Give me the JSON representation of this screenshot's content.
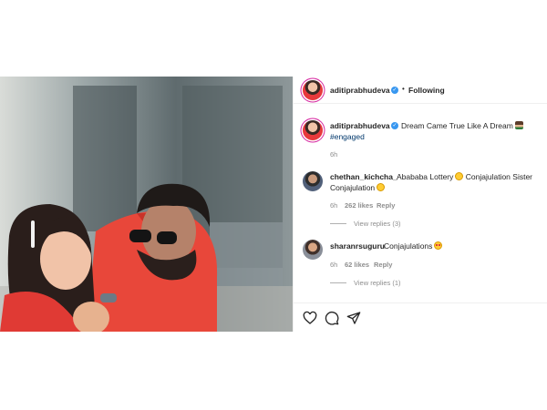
{
  "post": {
    "author": "aditiprabhudeva",
    "separator": "•",
    "follow_label": "Following",
    "caption": {
      "text": "Dream Came True Like A Dream",
      "emoji": "couple-emoji",
      "hashtag": "#engaged",
      "time": "6h"
    }
  },
  "comments": [
    {
      "username": "chethan_kichcha_",
      "text": "Abababa Lottery",
      "text2": "Conjajulation Sister",
      "text3": "Conjajulation",
      "time": "6h",
      "likes": "262 likes",
      "reply_label": "Reply",
      "view_replies": "View replies (3)"
    },
    {
      "username": "sharanrsuguru",
      "text": "Conjajulations",
      "time": "6h",
      "likes": "62 likes",
      "reply_label": "Reply",
      "view_replies": "View replies (1)"
    }
  ],
  "icons": {
    "verified": "verified-badge-icon",
    "like": "heart-icon",
    "comment": "comment-bubble-icon",
    "share": "paper-plane-icon"
  },
  "colors": {
    "verified": "#3897f0",
    "hashtag": "#00376b",
    "muted": "#8e8e8e",
    "text": "#262626"
  }
}
